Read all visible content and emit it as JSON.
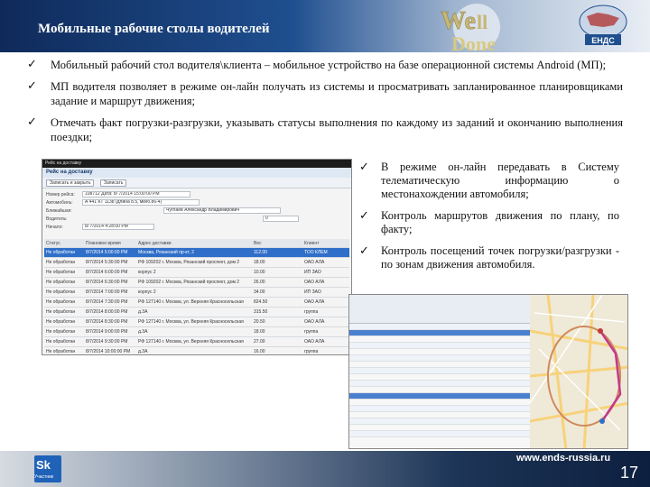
{
  "header": {
    "title": "Мобильные рабочие столы водителей",
    "logo_text": "Well Done",
    "badge_text": "ЕНДС"
  },
  "bullets": [
    "Мобильный рабочий стол водителя\\клиента – мобильное устройство на базе операционной системы Android (МП);",
    "МП водителя позволяет в режиме он-лайн получать из системы и просматривать запланированное планировщиками задание и маршрут движения;",
    "Отмечать факт погрузки-разгрузки, указывать статусы выполнения по каждому из заданий и окончанию выполнения поездки;"
  ],
  "right_bullets": [
    "В режиме он-лайн передавать в Систему телематическую информацию о местонахождении автомобиля;",
    "Контроль маршрутов движения по плану, по факту;",
    "Контроль посещений точек погрузки/разгрузки - по зонам движения автомобиля."
  ],
  "app_screen": {
    "status_bar": "Рейс на доставку",
    "title": "Рейс на доставку",
    "buttons": [
      "Записать и закрыть",
      "Записать"
    ],
    "fields": [
      {
        "label": "Номер рейса:",
        "value": "108712  Дата: 8/ 7/2014 15:00:00 PM"
      },
      {
        "label": "Автомобиль:",
        "value": "А 441 КТ 1138 (длина 8.5, мкнб.86-4)"
      },
      {
        "label": "Ближайшая:",
        "value": "Чуглаев Александр Владимирович"
      },
      {
        "label": "Водитель:",
        "value": "0"
      },
      {
        "label": "Начало:",
        "value": "8/ 7/2014 4:28:00 PM"
      }
    ],
    "columns": [
      "Статус",
      "Плановое время",
      "Адрес доставки",
      "Вес",
      "Клиент"
    ],
    "rows": [
      {
        "status": "Не обработан",
        "time": "8/7/2014 5:00:00 PM",
        "address": "Москва, Рязанский пр-кт, 2",
        "weight": "112.00",
        "client": "ТОО КЛЕМ"
      },
      {
        "status": "Не обработан",
        "time": "8/7/2014 5:30:00 PM",
        "address": "РФ 109202 г. Москва, Рязанский проспект, дом 2",
        "weight": "18.00",
        "client": "ОАО АЛА"
      },
      {
        "status": "Не обработан",
        "time": "8/7/2014 6:00:00 PM",
        "address": "корпус 2",
        "weight": "10.00",
        "client": "ИП ЗАО"
      },
      {
        "status": "Не обработан",
        "time": "8/7/2014 6:30:00 PM",
        "address": "РФ 109202 г. Москва, Рязанский проспект, дом 2",
        "weight": "26.00",
        "client": "ОАО АЛА"
      },
      {
        "status": "Не обработан",
        "time": "8/7/2014 7:00:00 PM",
        "address": "корпус 2",
        "weight": "34.00",
        "client": "ИП ЗАО"
      },
      {
        "status": "Не обработан",
        "time": "8/7/2014 7:30:00 PM",
        "address": "РФ 127140 г. Москва, ул. Верхняя Красносельская",
        "weight": "824.50",
        "client": "ОАО АЛА"
      },
      {
        "status": "Не обработан",
        "time": "8/7/2014 8:00:00 PM",
        "address": "д.3А",
        "weight": "315.50",
        "client": "группа"
      },
      {
        "status": "Не обработан",
        "time": "8/7/2014 8:30:00 PM",
        "address": "РФ 127140 г. Москва, ул. Верхняя Красносельская",
        "weight": "20.50",
        "client": "ОАО АЛА"
      },
      {
        "status": "Не обработан",
        "time": "8/7/2014 9:00:00 PM",
        "address": "д.3А",
        "weight": "18.00",
        "client": "группа"
      },
      {
        "status": "Не обработан",
        "time": "8/7/2014 9:30:00 PM",
        "address": "РФ 127140 г. Москва, ул. Верхняя Красносельская",
        "weight": "27.00",
        "client": "ОАО АЛА"
      },
      {
        "status": "Не обработан",
        "time": "8/7/2014 10:00:00 PM",
        "address": "д.3А",
        "weight": "16.00",
        "client": "группа"
      }
    ]
  },
  "footer": {
    "brand": "Sk",
    "brand_sub": "Участник",
    "url": "www.ends-russia.ru",
    "page": "17"
  },
  "colors": {
    "header_dark": "#0f2a5a",
    "selected_row": "#2f6fc9",
    "footer_dark": "#0d1f3f"
  }
}
